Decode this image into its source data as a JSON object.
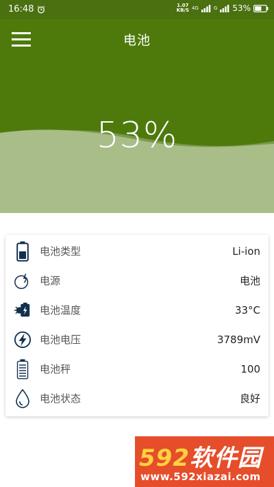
{
  "status_bar": {
    "time": "16:48",
    "alarm_icon": "alarm-clock-icon",
    "speed_value": "1.07",
    "speed_unit": "KB/S",
    "network_1": "4G",
    "network_2": "G",
    "battery_text": "53%",
    "icons": [
      "signal-bars-icon",
      "battery-icon"
    ]
  },
  "app_bar": {
    "title": "电池",
    "menu_icon": "hamburger-menu-icon"
  },
  "battery": {
    "percent_text": "53%",
    "level": 53,
    "colors": {
      "dark": "#4e7a0c",
      "light": "#a9bd88"
    }
  },
  "info": {
    "rows": [
      {
        "icon": "battery-type-icon",
        "label": "电池类型",
        "value": "Li-ion"
      },
      {
        "icon": "power-source-icon",
        "label": "电源",
        "value": "电池"
      },
      {
        "icon": "temperature-icon",
        "label": "电池温度",
        "value": "33°C"
      },
      {
        "icon": "voltage-icon",
        "label": "电池电压",
        "value": "3789mV"
      },
      {
        "icon": "battery-scale-icon",
        "label": "电池秤",
        "value": "100"
      },
      {
        "icon": "battery-health-icon",
        "label": "电池状态",
        "value": "良好"
      }
    ]
  },
  "watermark": {
    "brand_num": "592",
    "brand_text": "软件园",
    "url": "www.592xiazai.com"
  }
}
